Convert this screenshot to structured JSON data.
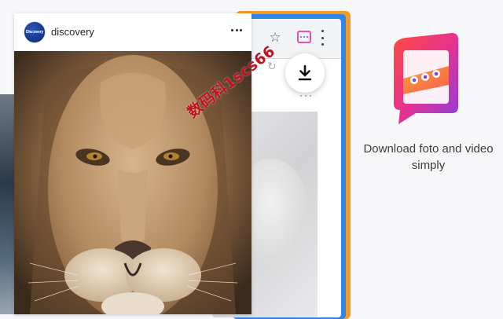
{
  "post": {
    "username": "discovery",
    "avatar_text": "Discovery"
  },
  "watermark": "数码科1scs66",
  "promo": {
    "tagline": "Download foto and video simply"
  },
  "icons": {
    "more": "more-horizontal-icon",
    "star": "star-icon",
    "extension": "extension-icon",
    "menu": "kebab-menu-icon",
    "download": "download-icon",
    "reload": "reload-icon",
    "logo": "app-logo-icon"
  },
  "colors": {
    "frame_orange": "#f59a28",
    "frame_blue": "#2f86e6",
    "brand_gradient": [
      "#ff4a3d",
      "#e6338f",
      "#8a3ee0",
      "#f39a1f"
    ],
    "watermark": "#c1121f"
  }
}
